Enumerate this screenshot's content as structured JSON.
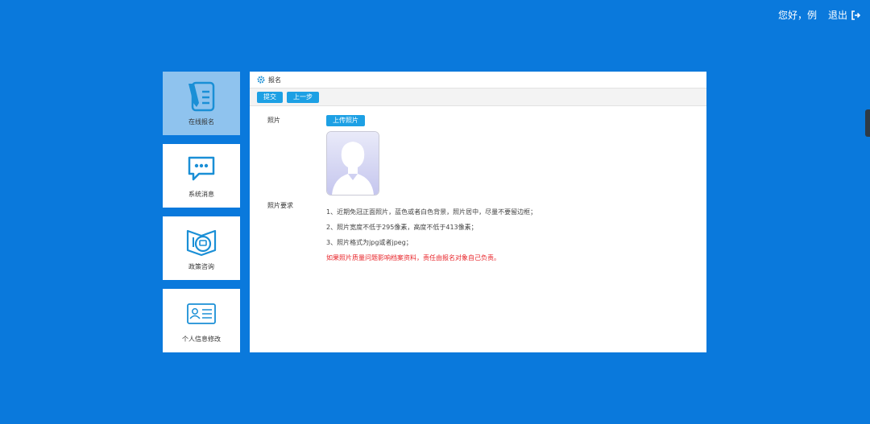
{
  "header": {
    "greeting": "您好，例",
    "logout_label": "退出"
  },
  "nav": {
    "items": [
      {
        "label": "在线报名",
        "icon": "form-pen-icon",
        "active": true
      },
      {
        "label": "系统消息",
        "icon": "chat-bubble-icon",
        "active": false
      },
      {
        "label": "政策咨询",
        "icon": "book-chat-icon",
        "active": false
      },
      {
        "label": "个人信息修改",
        "icon": "id-card-icon",
        "active": false
      }
    ]
  },
  "panel": {
    "title": "报名",
    "buttons": {
      "submit": "提交",
      "prev": "上一步"
    },
    "photo_label": "照片",
    "upload_label": "上传照片",
    "req_label": "照片要求",
    "requirements": [
      "1、近期免冠正面照片，蓝色或者白色背景，照片居中，尽量不要留边框；",
      "2、照片宽度不低于295像素，高度不低于413像素；",
      "3、照片格式为jpg或者jpeg；"
    ],
    "warning": "如果照片质量问题影响档案资料，责任由报名对象自己负责。"
  },
  "colors": {
    "background": "#0a79dc",
    "nav_active": "#8fc3ee",
    "button": "#1da0e4",
    "warning": "#e8262b",
    "icon": "#1a8fd6"
  }
}
